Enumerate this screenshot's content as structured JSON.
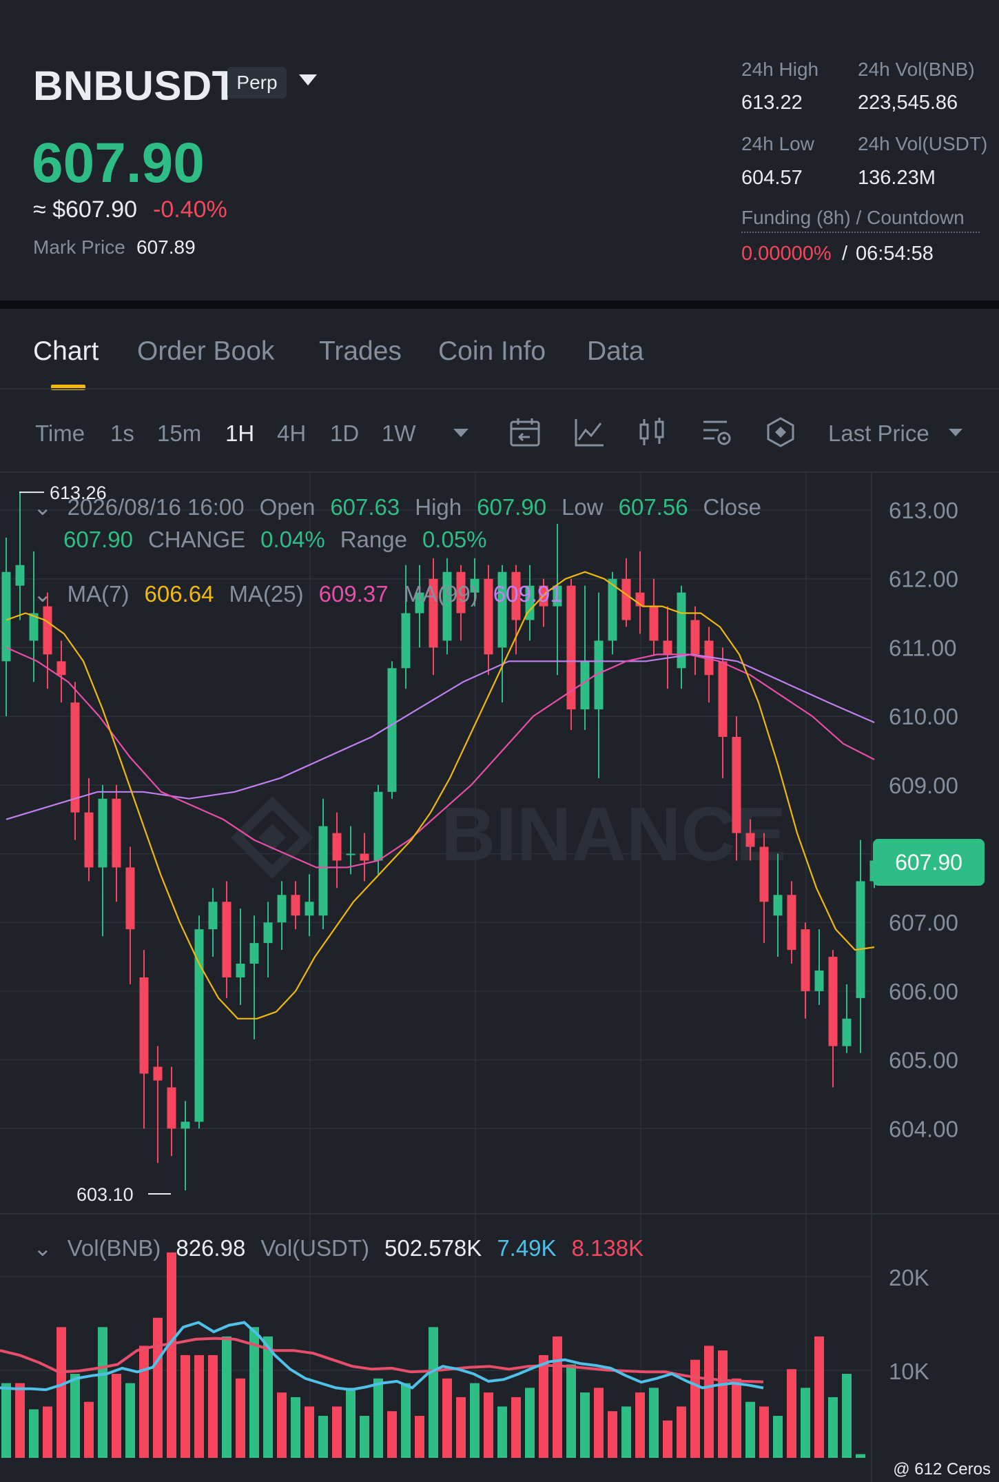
{
  "header": {
    "symbol": "BNBUSDT",
    "contract_badge": "Perp",
    "last_price": "607.90",
    "usd_approx": "≈ $607.90",
    "change_pct": "-0.40%",
    "mark_price_label": "Mark Price",
    "mark_price_value": "607.89",
    "stats": {
      "high_label": "24h High",
      "high_value": "613.22",
      "vol_bnb_label": "24h Vol(BNB)",
      "vol_bnb_value": "223,545.86",
      "low_label": "24h Low",
      "low_value": "604.57",
      "vol_usdt_label": "24h Vol(USDT)",
      "vol_usdt_value": "136.23M",
      "funding_label": "Funding (8h) / Countdown",
      "funding_rate": "0.00000%",
      "funding_sep": "/",
      "countdown": "06:54:58"
    }
  },
  "tabs": [
    {
      "label": "Chart",
      "active": true
    },
    {
      "label": "Order Book",
      "active": false
    },
    {
      "label": "Trades",
      "active": false
    },
    {
      "label": "Coin Info",
      "active": false
    },
    {
      "label": "Data",
      "active": false
    }
  ],
  "toolbar": {
    "time_label": "Time",
    "intervals": [
      "1s",
      "15m",
      "1H",
      "4H",
      "1D",
      "1W"
    ],
    "active_interval": "1H",
    "price_type": "Last Price",
    "icons": [
      "calendar-icon",
      "indicator-icon",
      "candle-type-icon",
      "chart-settings-icon",
      "binance-logo-icon"
    ]
  },
  "legend": {
    "datetime": "2026/08/16 16:00",
    "open_label": "Open",
    "open": "607.63",
    "high_label": "High",
    "high": "607.90",
    "low_label": "Low",
    "low": "607.56",
    "close_label": "Close",
    "close": "607.90",
    "change_label": "CHANGE",
    "change": "0.04%",
    "range_label": "Range",
    "range": "0.05%",
    "ma7_label": "MA(7)",
    "ma7": "606.64",
    "ma25_label": "MA(25)",
    "ma25": "609.37",
    "ma99_label": "MA(99)",
    "ma99": "609.91"
  },
  "volume_legend": {
    "vol_bnb_label": "Vol(BNB)",
    "vol_bnb": "826.98",
    "vol_usdt_label": "Vol(USDT)",
    "vol_usdt": "502.578K",
    "ma5": "7.49K",
    "ma10": "8.138K"
  },
  "watermark": "BINANCE",
  "credit": "@ 612 Ceros",
  "price_tag": "607.90",
  "colors": {
    "up": "#2ebd85",
    "down": "#f6465d",
    "ma7": "#f0b90b",
    "ma25": "#e84ea8",
    "ma99": "#c080f0",
    "vol_ma5": "#4fc1e9",
    "vol_ma10": "#e84e6a",
    "accent": "#f0b90b"
  },
  "chart_data": {
    "type": "candlestick",
    "y_axis_ticks": [
      "613.00",
      "612.00",
      "611.00",
      "610.00",
      "609.00",
      "608.00",
      "607.00",
      "606.00",
      "605.00",
      "604.00"
    ],
    "ylim": [
      603.0,
      613.3
    ],
    "marked_high": "613.26",
    "marked_low": "603.10",
    "candles": [
      {
        "o": 610.8,
        "h": 612.6,
        "l": 610.0,
        "c": 612.1
      },
      {
        "o": 611.9,
        "h": 613.26,
        "l": 611.4,
        "c": 612.2
      },
      {
        "o": 611.1,
        "h": 612.4,
        "l": 610.5,
        "c": 611.5
      },
      {
        "o": 611.6,
        "h": 611.8,
        "l": 610.4,
        "c": 610.9
      },
      {
        "o": 610.8,
        "h": 611.1,
        "l": 610.2,
        "c": 610.6
      },
      {
        "o": 610.2,
        "h": 610.5,
        "l": 608.2,
        "c": 608.6
      },
      {
        "o": 608.6,
        "h": 609.1,
        "l": 607.6,
        "c": 607.8
      },
      {
        "o": 607.8,
        "h": 609.0,
        "l": 606.8,
        "c": 608.8
      },
      {
        "o": 608.8,
        "h": 609.0,
        "l": 607.3,
        "c": 607.8
      },
      {
        "o": 607.8,
        "h": 608.1,
        "l": 606.1,
        "c": 606.9
      },
      {
        "o": 606.2,
        "h": 606.6,
        "l": 604.0,
        "c": 604.8
      },
      {
        "o": 604.9,
        "h": 605.2,
        "l": 603.5,
        "c": 604.7
      },
      {
        "o": 604.6,
        "h": 604.9,
        "l": 603.6,
        "c": 604.0
      },
      {
        "o": 604.0,
        "h": 604.4,
        "l": 603.1,
        "c": 604.1
      },
      {
        "o": 604.1,
        "h": 607.1,
        "l": 604.0,
        "c": 606.9
      },
      {
        "o": 606.9,
        "h": 607.5,
        "l": 606.5,
        "c": 607.3
      },
      {
        "o": 607.3,
        "h": 607.6,
        "l": 605.9,
        "c": 606.2
      },
      {
        "o": 606.2,
        "h": 607.2,
        "l": 605.8,
        "c": 606.4
      },
      {
        "o": 606.4,
        "h": 607.1,
        "l": 605.3,
        "c": 606.7
      },
      {
        "o": 606.7,
        "h": 607.3,
        "l": 606.2,
        "c": 607.0
      },
      {
        "o": 607.0,
        "h": 607.6,
        "l": 606.6,
        "c": 607.4
      },
      {
        "o": 607.4,
        "h": 607.6,
        "l": 606.9,
        "c": 607.1
      },
      {
        "o": 607.1,
        "h": 607.7,
        "l": 606.8,
        "c": 607.3
      },
      {
        "o": 607.1,
        "h": 608.8,
        "l": 606.9,
        "c": 608.4
      },
      {
        "o": 608.3,
        "h": 608.6,
        "l": 607.5,
        "c": 607.9
      },
      {
        "o": 608.0,
        "h": 608.4,
        "l": 607.7,
        "c": 608.0
      },
      {
        "o": 608.0,
        "h": 608.3,
        "l": 607.6,
        "c": 607.9
      },
      {
        "o": 607.9,
        "h": 609.0,
        "l": 607.7,
        "c": 608.9
      },
      {
        "o": 608.9,
        "h": 610.8,
        "l": 608.8,
        "c": 610.7
      },
      {
        "o": 610.7,
        "h": 612.2,
        "l": 610.4,
        "c": 611.5
      },
      {
        "o": 611.5,
        "h": 612.2,
        "l": 611.0,
        "c": 611.8
      },
      {
        "o": 612.0,
        "h": 612.3,
        "l": 610.6,
        "c": 611.0
      },
      {
        "o": 611.1,
        "h": 612.3,
        "l": 610.9,
        "c": 612.1
      },
      {
        "o": 612.1,
        "h": 612.2,
        "l": 611.1,
        "c": 611.5
      },
      {
        "o": 611.8,
        "h": 612.3,
        "l": 611.6,
        "c": 612.0
      },
      {
        "o": 612.0,
        "h": 612.2,
        "l": 610.6,
        "c": 610.9
      },
      {
        "o": 611.0,
        "h": 612.2,
        "l": 610.2,
        "c": 612.1
      },
      {
        "o": 612.1,
        "h": 612.2,
        "l": 610.9,
        "c": 611.4
      },
      {
        "o": 611.4,
        "h": 612.2,
        "l": 611.1,
        "c": 611.9
      },
      {
        "o": 611.9,
        "h": 612.0,
        "l": 611.3,
        "c": 611.6
      },
      {
        "o": 611.6,
        "h": 612.8,
        "l": 610.6,
        "c": 611.9
      },
      {
        "o": 611.9,
        "h": 612.0,
        "l": 609.8,
        "c": 610.1
      },
      {
        "o": 610.1,
        "h": 611.9,
        "l": 609.8,
        "c": 610.8
      },
      {
        "o": 610.1,
        "h": 611.8,
        "l": 609.1,
        "c": 611.1
      },
      {
        "o": 611.1,
        "h": 612.1,
        "l": 610.9,
        "c": 612.0
      },
      {
        "o": 612.0,
        "h": 612.3,
        "l": 611.3,
        "c": 611.4
      },
      {
        "o": 611.8,
        "h": 612.4,
        "l": 611.2,
        "c": 611.6
      },
      {
        "o": 611.6,
        "h": 612.0,
        "l": 610.9,
        "c": 611.1
      },
      {
        "o": 611.1,
        "h": 611.6,
        "l": 610.4,
        "c": 610.9
      },
      {
        "o": 610.7,
        "h": 611.9,
        "l": 610.4,
        "c": 611.8
      },
      {
        "o": 611.4,
        "h": 611.6,
        "l": 610.6,
        "c": 610.9
      },
      {
        "o": 611.1,
        "h": 611.3,
        "l": 610.2,
        "c": 610.6
      },
      {
        "o": 610.8,
        "h": 611.0,
        "l": 609.1,
        "c": 609.7
      },
      {
        "o": 609.7,
        "h": 610.0,
        "l": 607.9,
        "c": 608.3
      },
      {
        "o": 608.3,
        "h": 608.5,
        "l": 607.9,
        "c": 608.1
      },
      {
        "o": 608.1,
        "h": 608.3,
        "l": 606.7,
        "c": 607.3
      },
      {
        "o": 607.1,
        "h": 608.0,
        "l": 606.5,
        "c": 607.4
      },
      {
        "o": 607.4,
        "h": 607.6,
        "l": 606.4,
        "c": 606.6
      },
      {
        "o": 606.9,
        "h": 607.0,
        "l": 605.6,
        "c": 606.0
      },
      {
        "o": 606.0,
        "h": 606.9,
        "l": 605.8,
        "c": 606.3
      },
      {
        "o": 606.5,
        "h": 606.6,
        "l": 604.6,
        "c": 605.2
      },
      {
        "o": 605.2,
        "h": 606.1,
        "l": 605.1,
        "c": 605.6
      },
      {
        "o": 605.9,
        "h": 608.2,
        "l": 605.1,
        "c": 607.6
      },
      {
        "o": 607.6,
        "h": 607.9,
        "l": 607.5,
        "c": 607.9
      }
    ],
    "ma7": [
      611.4,
      611.5,
      611.4,
      611.2,
      610.8,
      610.1,
      609.3,
      608.5,
      607.7,
      607.0,
      606.4,
      605.9,
      605.6,
      605.6,
      605.7,
      606.0,
      606.5,
      606.9,
      607.3,
      607.6,
      607.9,
      608.2,
      608.6,
      609.1,
      609.7,
      610.3,
      610.9,
      611.5,
      611.8,
      612.0,
      612.1,
      612.0,
      611.8,
      611.6,
      611.6,
      611.5,
      611.5,
      611.3,
      610.9,
      610.2,
      609.3,
      608.3,
      607.5,
      606.9,
      606.6,
      606.64
    ],
    "ma25": [
      611.0,
      610.8,
      610.5,
      610.0,
      609.4,
      608.9,
      608.7,
      608.5,
      608.2,
      608.0,
      607.8,
      607.8,
      607.9,
      608.2,
      608.6,
      609.0,
      609.5,
      610.0,
      610.3,
      610.6,
      610.8,
      610.9,
      610.9,
      610.8,
      610.6,
      610.3,
      610.0,
      609.6,
      609.37
    ],
    "ma99": [
      608.5,
      608.7,
      608.9,
      608.9,
      608.8,
      608.9,
      609.1,
      609.4,
      609.7,
      610.1,
      610.5,
      610.8,
      610.8,
      610.8,
      610.8,
      610.9,
      610.8,
      610.5,
      610.2,
      609.91
    ],
    "volume_ticks": [
      "20K",
      "10K"
    ],
    "volume": [
      {
        "v": 8000,
        "up": true
      },
      {
        "v": 8000,
        "up": false
      },
      {
        "v": 5200,
        "up": true
      },
      {
        "v": 5500,
        "up": false
      },
      {
        "v": 14000,
        "up": false
      },
      {
        "v": 9000,
        "up": true
      },
      {
        "v": 6000,
        "up": false
      },
      {
        "v": 14000,
        "up": true
      },
      {
        "v": 9000,
        "up": false
      },
      {
        "v": 8000,
        "up": true
      },
      {
        "v": 12000,
        "up": false
      },
      {
        "v": 15000,
        "up": false
      },
      {
        "v": 22000,
        "up": false
      },
      {
        "v": 11000,
        "up": false
      },
      {
        "v": 11000,
        "up": false
      },
      {
        "v": 11000,
        "up": false
      },
      {
        "v": 13000,
        "up": true
      },
      {
        "v": 8500,
        "up": false
      },
      {
        "v": 14000,
        "up": true
      },
      {
        "v": 13000,
        "up": true
      },
      {
        "v": 7000,
        "up": false
      },
      {
        "v": 6500,
        "up": true
      },
      {
        "v": 5500,
        "up": false
      },
      {
        "v": 4500,
        "up": true
      },
      {
        "v": 5500,
        "up": false
      },
      {
        "v": 7500,
        "up": true
      },
      {
        "v": 4500,
        "up": true
      },
      {
        "v": 8500,
        "up": true
      },
      {
        "v": 5000,
        "up": false
      },
      {
        "v": 8000,
        "up": true
      },
      {
        "v": 4500,
        "up": false
      },
      {
        "v": 14000,
        "up": true
      },
      {
        "v": 8500,
        "up": false
      },
      {
        "v": 6500,
        "up": false
      },
      {
        "v": 8000,
        "up": true
      },
      {
        "v": 7000,
        "up": false
      },
      {
        "v": 5500,
        "up": true
      },
      {
        "v": 6500,
        "up": false
      },
      {
        "v": 7500,
        "up": true
      },
      {
        "v": 11000,
        "up": false
      },
      {
        "v": 13000,
        "up": false
      },
      {
        "v": 10000,
        "up": true
      },
      {
        "v": 7000,
        "up": true
      },
      {
        "v": 7500,
        "up": false
      },
      {
        "v": 5000,
        "up": false
      },
      {
        "v": 5500,
        "up": true
      },
      {
        "v": 7000,
        "up": false
      },
      {
        "v": 7500,
        "up": true
      },
      {
        "v": 4000,
        "up": false
      },
      {
        "v": 5500,
        "up": false
      },
      {
        "v": 10500,
        "up": false
      },
      {
        "v": 12000,
        "up": false
      },
      {
        "v": 11500,
        "up": false
      },
      {
        "v": 8500,
        "up": false
      },
      {
        "v": 6000,
        "up": true
      },
      {
        "v": 5500,
        "up": false
      },
      {
        "v": 4500,
        "up": true
      },
      {
        "v": 9500,
        "up": false
      },
      {
        "v": 7500,
        "up": true
      },
      {
        "v": 13000,
        "up": false
      },
      {
        "v": 6500,
        "up": true
      },
      {
        "v": 9000,
        "up": true
      },
      {
        "v": 400,
        "up": true
      }
    ],
    "vol_ma5": [
      7500,
      7400,
      7400,
      7300,
      7800,
      8500,
      8800,
      9000,
      9600,
      9200,
      9700,
      12000,
      14000,
      14500,
      13500,
      14200,
      14500,
      13000,
      11000,
      9500,
      8500,
      8000,
      7500,
      7300,
      7600,
      8000,
      8200,
      7500,
      9000,
      9800,
      9500,
      9000,
      8200,
      8400,
      9000,
      9700,
      10300,
      10500,
      10100,
      9900,
      9600,
      8800,
      8100,
      8500,
      9000,
      8200,
      7500,
      7800,
      8000,
      7800,
      7490
    ],
    "vol_ma10": [
      11500,
      11000,
      10200,
      9200,
      9300,
      9600,
      10000,
      11500,
      12000,
      12300,
      12700,
      12800,
      12700,
      12100,
      11500,
      11500,
      11200,
      10500,
      9800,
      9500,
      9600,
      9200,
      9300,
      9500,
      9700,
      9800,
      9500,
      9800,
      9900,
      9800,
      9600,
      9400,
      9300,
      9200,
      9200,
      8800,
      8500,
      8300,
      8200,
      8138
    ]
  }
}
